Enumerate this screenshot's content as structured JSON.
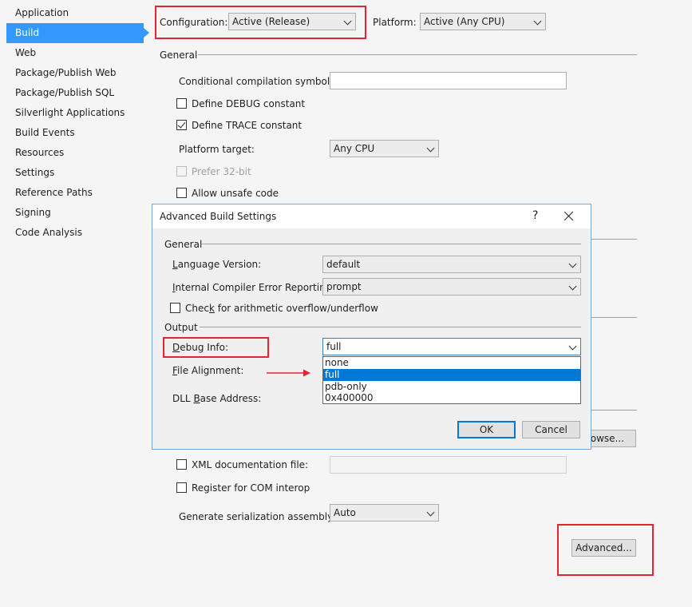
{
  "nav": {
    "items": [
      {
        "label": "Application",
        "active": false
      },
      {
        "label": "Build",
        "active": true
      },
      {
        "label": "Web",
        "active": false
      },
      {
        "label": "Package/Publish Web",
        "active": false
      },
      {
        "label": "Package/Publish SQL",
        "active": false
      },
      {
        "label": "Silverlight Applications",
        "active": false
      },
      {
        "label": "Build Events",
        "active": false
      },
      {
        "label": "Resources",
        "active": false
      },
      {
        "label": "Settings",
        "active": false
      },
      {
        "label": "Reference Paths",
        "active": false
      },
      {
        "label": "Signing",
        "active": false
      },
      {
        "label": "Code Analysis",
        "active": false
      }
    ]
  },
  "top": {
    "configuration_label": "Configuration:",
    "configuration_value": "Active (Release)",
    "platform_label": "Platform:",
    "platform_value": "Active (Any CPU)"
  },
  "general": {
    "header": "General",
    "symbols_label": "Conditional compilation symbols:",
    "symbols_value": "",
    "debug_label": "Define DEBUG constant",
    "debug_checked": false,
    "trace_label": "Define TRACE constant",
    "trace_checked": true,
    "platform_target_label": "Platform target:",
    "platform_target_value": "Any CPU",
    "prefer32_label": "Prefer 32-bit",
    "unsafe_label": "Allow unsafe code"
  },
  "output": {
    "browse_label": "rowse...",
    "xml_doc_label": "XML documentation file:",
    "xml_doc_value": "",
    "com_label": "Register for COM interop",
    "serialization_label": "Generate serialization assembly:",
    "serialization_value": "Auto",
    "advanced_label": "Advanced..."
  },
  "dialog": {
    "title": "Advanced Build Settings",
    "help": "?",
    "general_header": "General",
    "language_label_u": "L",
    "language_label_rest": "anguage Version:",
    "language_value": "default",
    "ice_label_u": "I",
    "ice_label_rest": "nternal Compiler Error Reporting:",
    "ice_value": "prompt",
    "overflow_label_pre": "Chec",
    "overflow_label_u": "k",
    "overflow_label_rest": " for arithmetic overflow/underflow",
    "output_header": "Output",
    "debug_info_label_u": "D",
    "debug_info_label_rest": "ebug Info:",
    "debug_info_value": "full",
    "debug_options": [
      "none",
      "full",
      "pdb-only",
      "0x400000"
    ],
    "debug_selected_index": 1,
    "file_alignment_label_u": "F",
    "file_alignment_label_rest": "ile Alignment:",
    "dll_base_label_pre": "DLL ",
    "dll_base_label_u": "B",
    "dll_base_label_rest": "ase Address:",
    "ok_label": "OK",
    "cancel_label": "Cancel"
  },
  "colors": {
    "accent": "#3399ff",
    "highlight_box": "#e3262e",
    "list_selection": "#0078d7"
  }
}
